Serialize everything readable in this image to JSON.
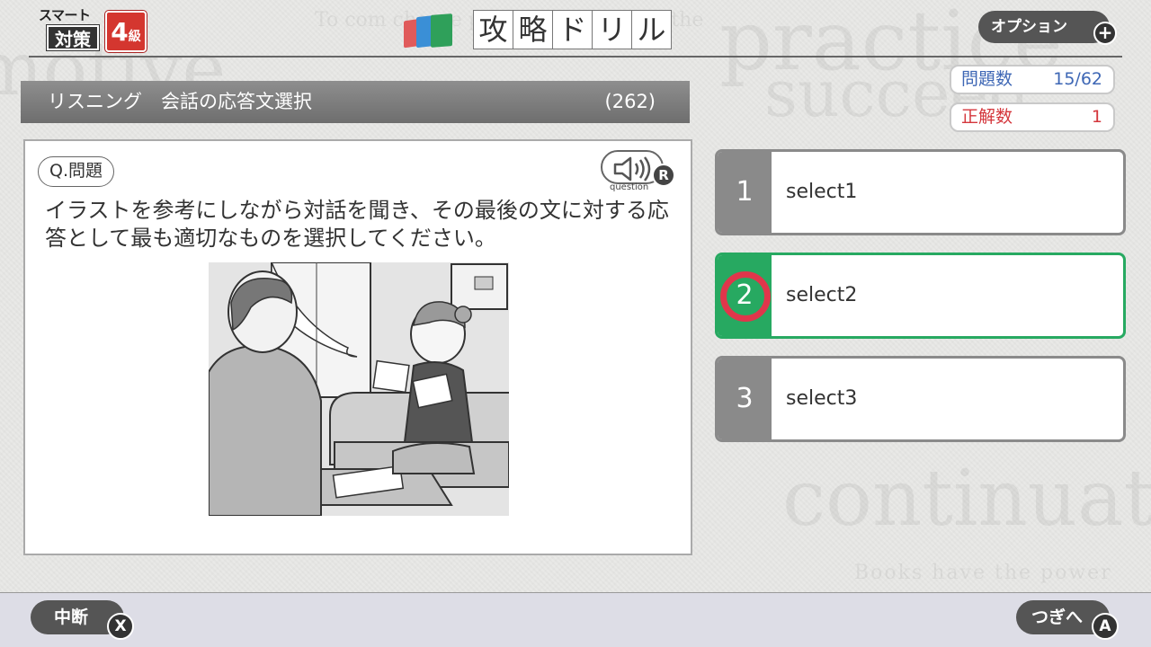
{
  "header": {
    "logo": {
      "top": "スマート",
      "main": "対策",
      "level_num": "4",
      "level_suffix": "級"
    },
    "title_chars": [
      "攻",
      "略",
      "ド",
      "リ",
      "ル"
    ],
    "option_label": "オプション",
    "option_icon": "plus-icon"
  },
  "stats": {
    "count_label": "問題数",
    "count_value": "15/62",
    "correct_label": "正解数",
    "correct_value": "1",
    "count_color": "#3e67b5",
    "correct_color": "#d4363c"
  },
  "category": {
    "label": "リスニング　会話の応答文選択",
    "number": "(262)"
  },
  "question": {
    "tag": "Q.問題",
    "speaker_label": "question",
    "speaker_badge": "R",
    "text": "イラストを参考にしながら対話を聞き、その最後の文に対する応答として最も適切なものを選択してください。"
  },
  "choices": [
    {
      "num": "1",
      "text": "select1"
    },
    {
      "num": "2",
      "text": "select2"
    },
    {
      "num": "3",
      "text": "select3"
    }
  ],
  "selected_color": "#27a961",
  "mark_color": "#e0364b",
  "footer": {
    "pause_label": "中断",
    "pause_badge": "X",
    "next_label": "つぎへ",
    "next_badge": "A"
  },
  "background_words": {
    "practice": "practice",
    "succeed": "succeed",
    "motive": "motive",
    "choose": "To com  choose  phrase from among the",
    "continuat": "continuat",
    "books": "Books have the power"
  }
}
